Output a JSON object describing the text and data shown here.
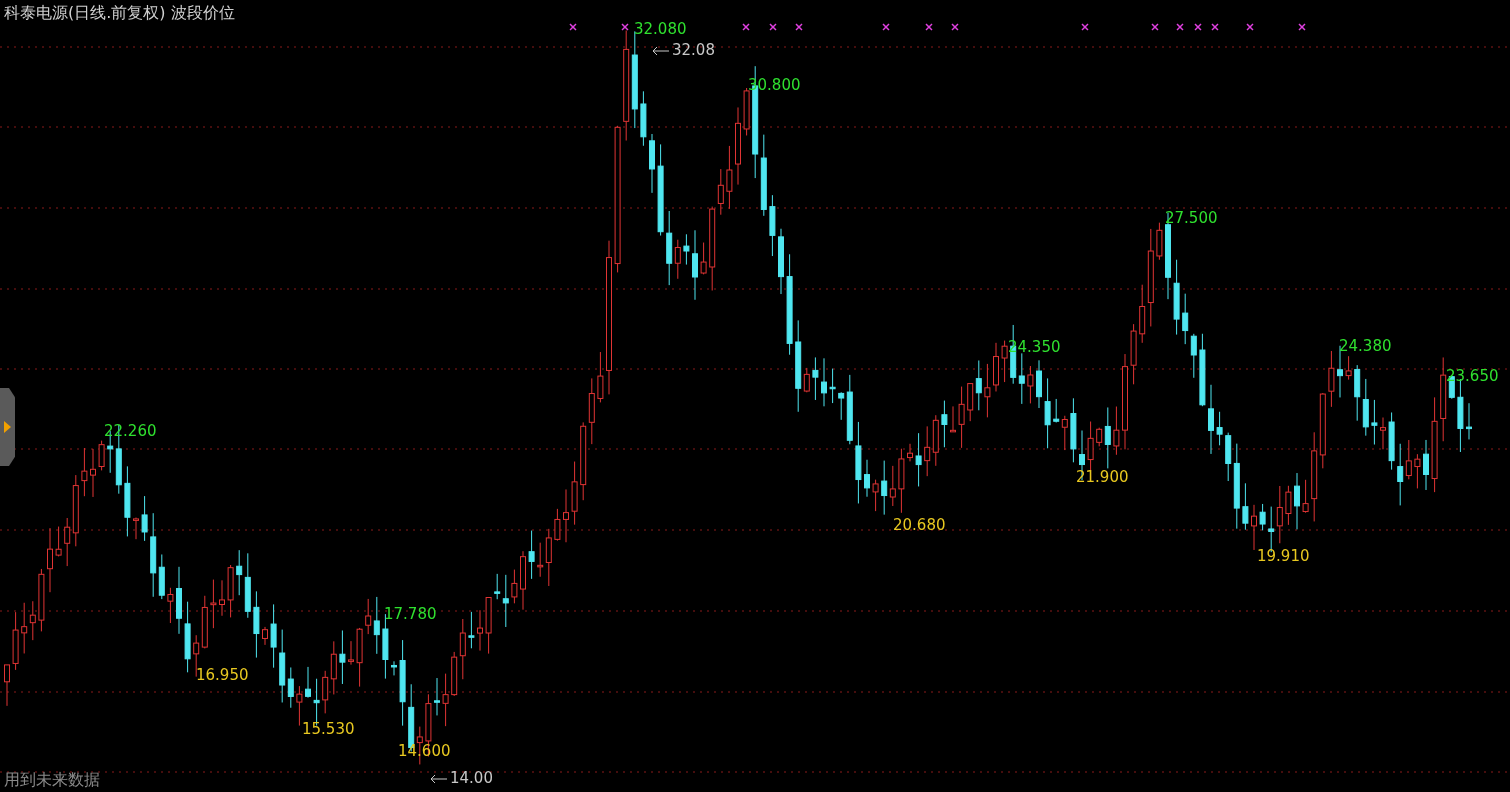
{
  "title": "科泰电源(日线.前复权) 波段价位",
  "wave_labels": [
    {
      "text": "22.260",
      "kind": "high"
    },
    {
      "text": "16.950",
      "kind": "low"
    },
    {
      "text": "15.530",
      "kind": "low"
    },
    {
      "text": "17.780",
      "kind": "high"
    },
    {
      "text": "14.600",
      "kind": "low"
    },
    {
      "text": "32.080",
      "kind": "high"
    },
    {
      "text": "30.800",
      "kind": "high"
    },
    {
      "text": "20.680",
      "kind": "low"
    },
    {
      "text": "24.350",
      "kind": "high"
    },
    {
      "text": "21.900",
      "kind": "low"
    },
    {
      "text": "27.500",
      "kind": "high"
    },
    {
      "text": "19.910",
      "kind": "low"
    },
    {
      "text": "24.380",
      "kind": "high"
    },
    {
      "text": "23.650",
      "kind": "high"
    }
  ],
  "price_marks": [
    {
      "text": "32.08"
    },
    {
      "text": "14.00"
    }
  ],
  "footer": "用到未来数据"
}
